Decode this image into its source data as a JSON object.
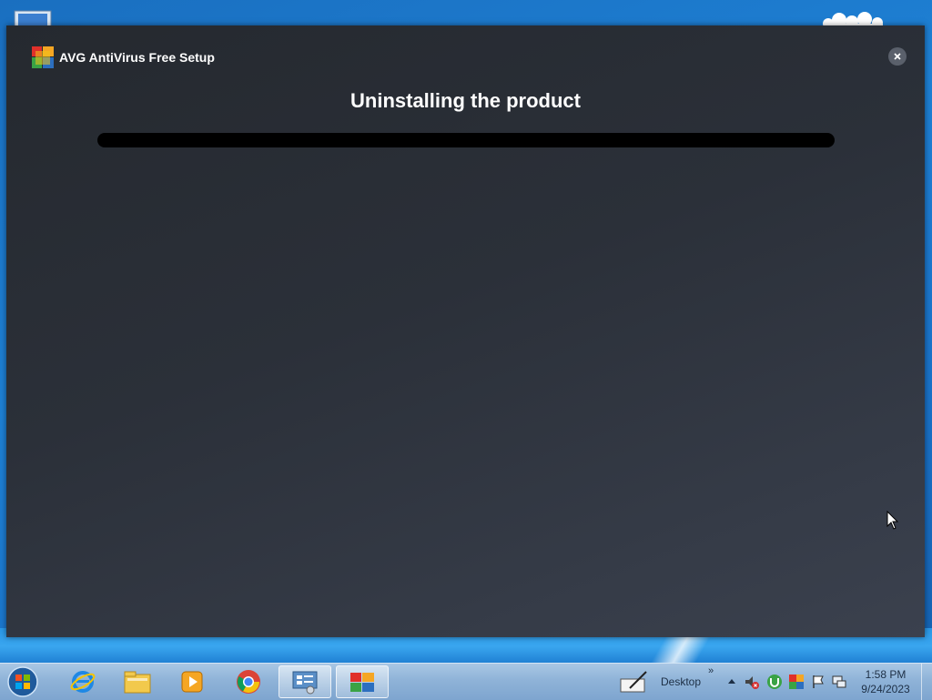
{
  "window": {
    "title": "AVG AntiVirus Free Setup",
    "heading": "Uninstalling the product",
    "progress_fraction": 0,
    "progress_color": "#000000"
  },
  "taskbar": {
    "items": [
      {
        "icon": "internet-explorer-icon"
      },
      {
        "icon": "file-explorer-icon"
      },
      {
        "icon": "media-player-icon"
      },
      {
        "icon": "chrome-icon"
      },
      {
        "icon": "control-panel-icon",
        "active": true
      },
      {
        "icon": "avg-icon",
        "active": true
      }
    ],
    "desktop_toolbar_label": "Desktop",
    "clock": {
      "time": "1:58 PM",
      "date": "9/24/2023"
    }
  },
  "colors": {
    "window_bg": "#2b3039",
    "taskbar_bg": "#8fb3d8",
    "desktop_bg": "#1e80d4"
  }
}
